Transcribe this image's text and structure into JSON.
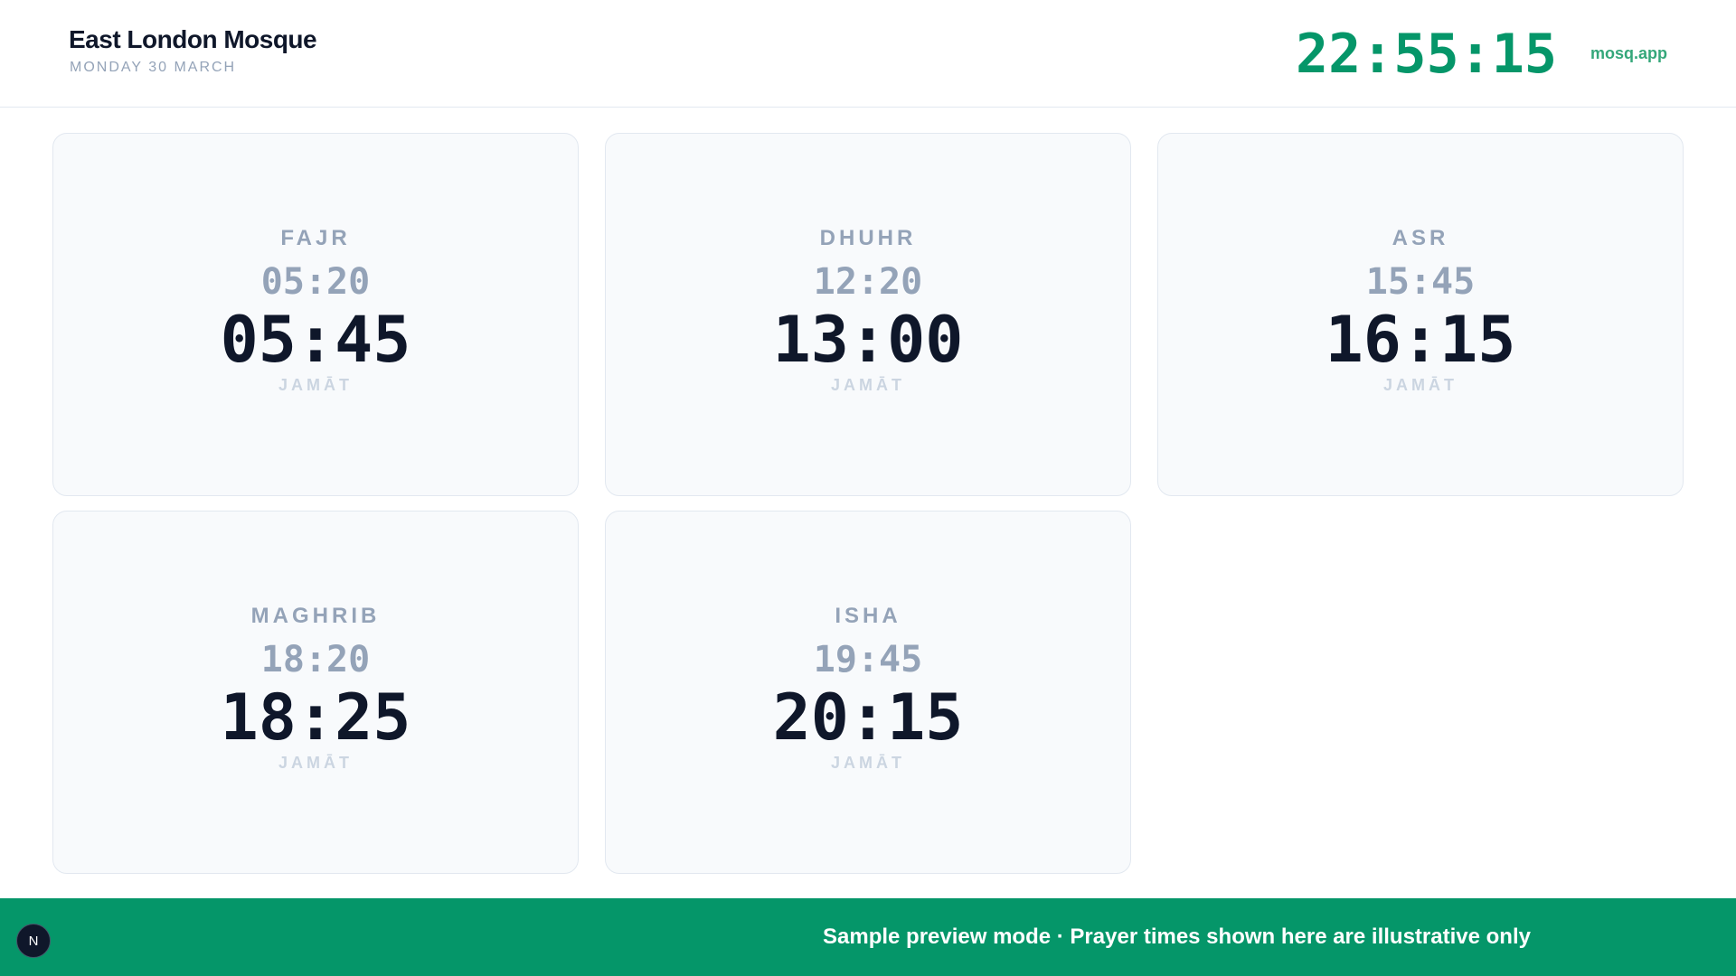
{
  "header": {
    "mosque_name": "East London Mosque",
    "date": "MONDAY 30 MARCH",
    "clock": "22:55:15",
    "brand": "mosq.app"
  },
  "prayers": [
    {
      "name": "FAJR",
      "start": "05:20",
      "jamat": "05:45",
      "jamat_label": "JAMĀT"
    },
    {
      "name": "DHUHR",
      "start": "12:20",
      "jamat": "13:00",
      "jamat_label": "JAMĀT"
    },
    {
      "name": "ASR",
      "start": "15:45",
      "jamat": "16:15",
      "jamat_label": "JAMĀT"
    },
    {
      "name": "MAGHRIB",
      "start": "18:20",
      "jamat": "18:25",
      "jamat_label": "JAMĀT"
    },
    {
      "name": "ISHA",
      "start": "19:45",
      "jamat": "20:15",
      "jamat_label": "JAMĀT"
    }
  ],
  "footer": {
    "message": "Sample preview mode · Prayer times shown here are illustrative only"
  },
  "badge": {
    "letter": "N"
  },
  "colors": {
    "accent": "#059669",
    "text_dark": "#0f172a",
    "text_muted": "#94a3b8"
  }
}
